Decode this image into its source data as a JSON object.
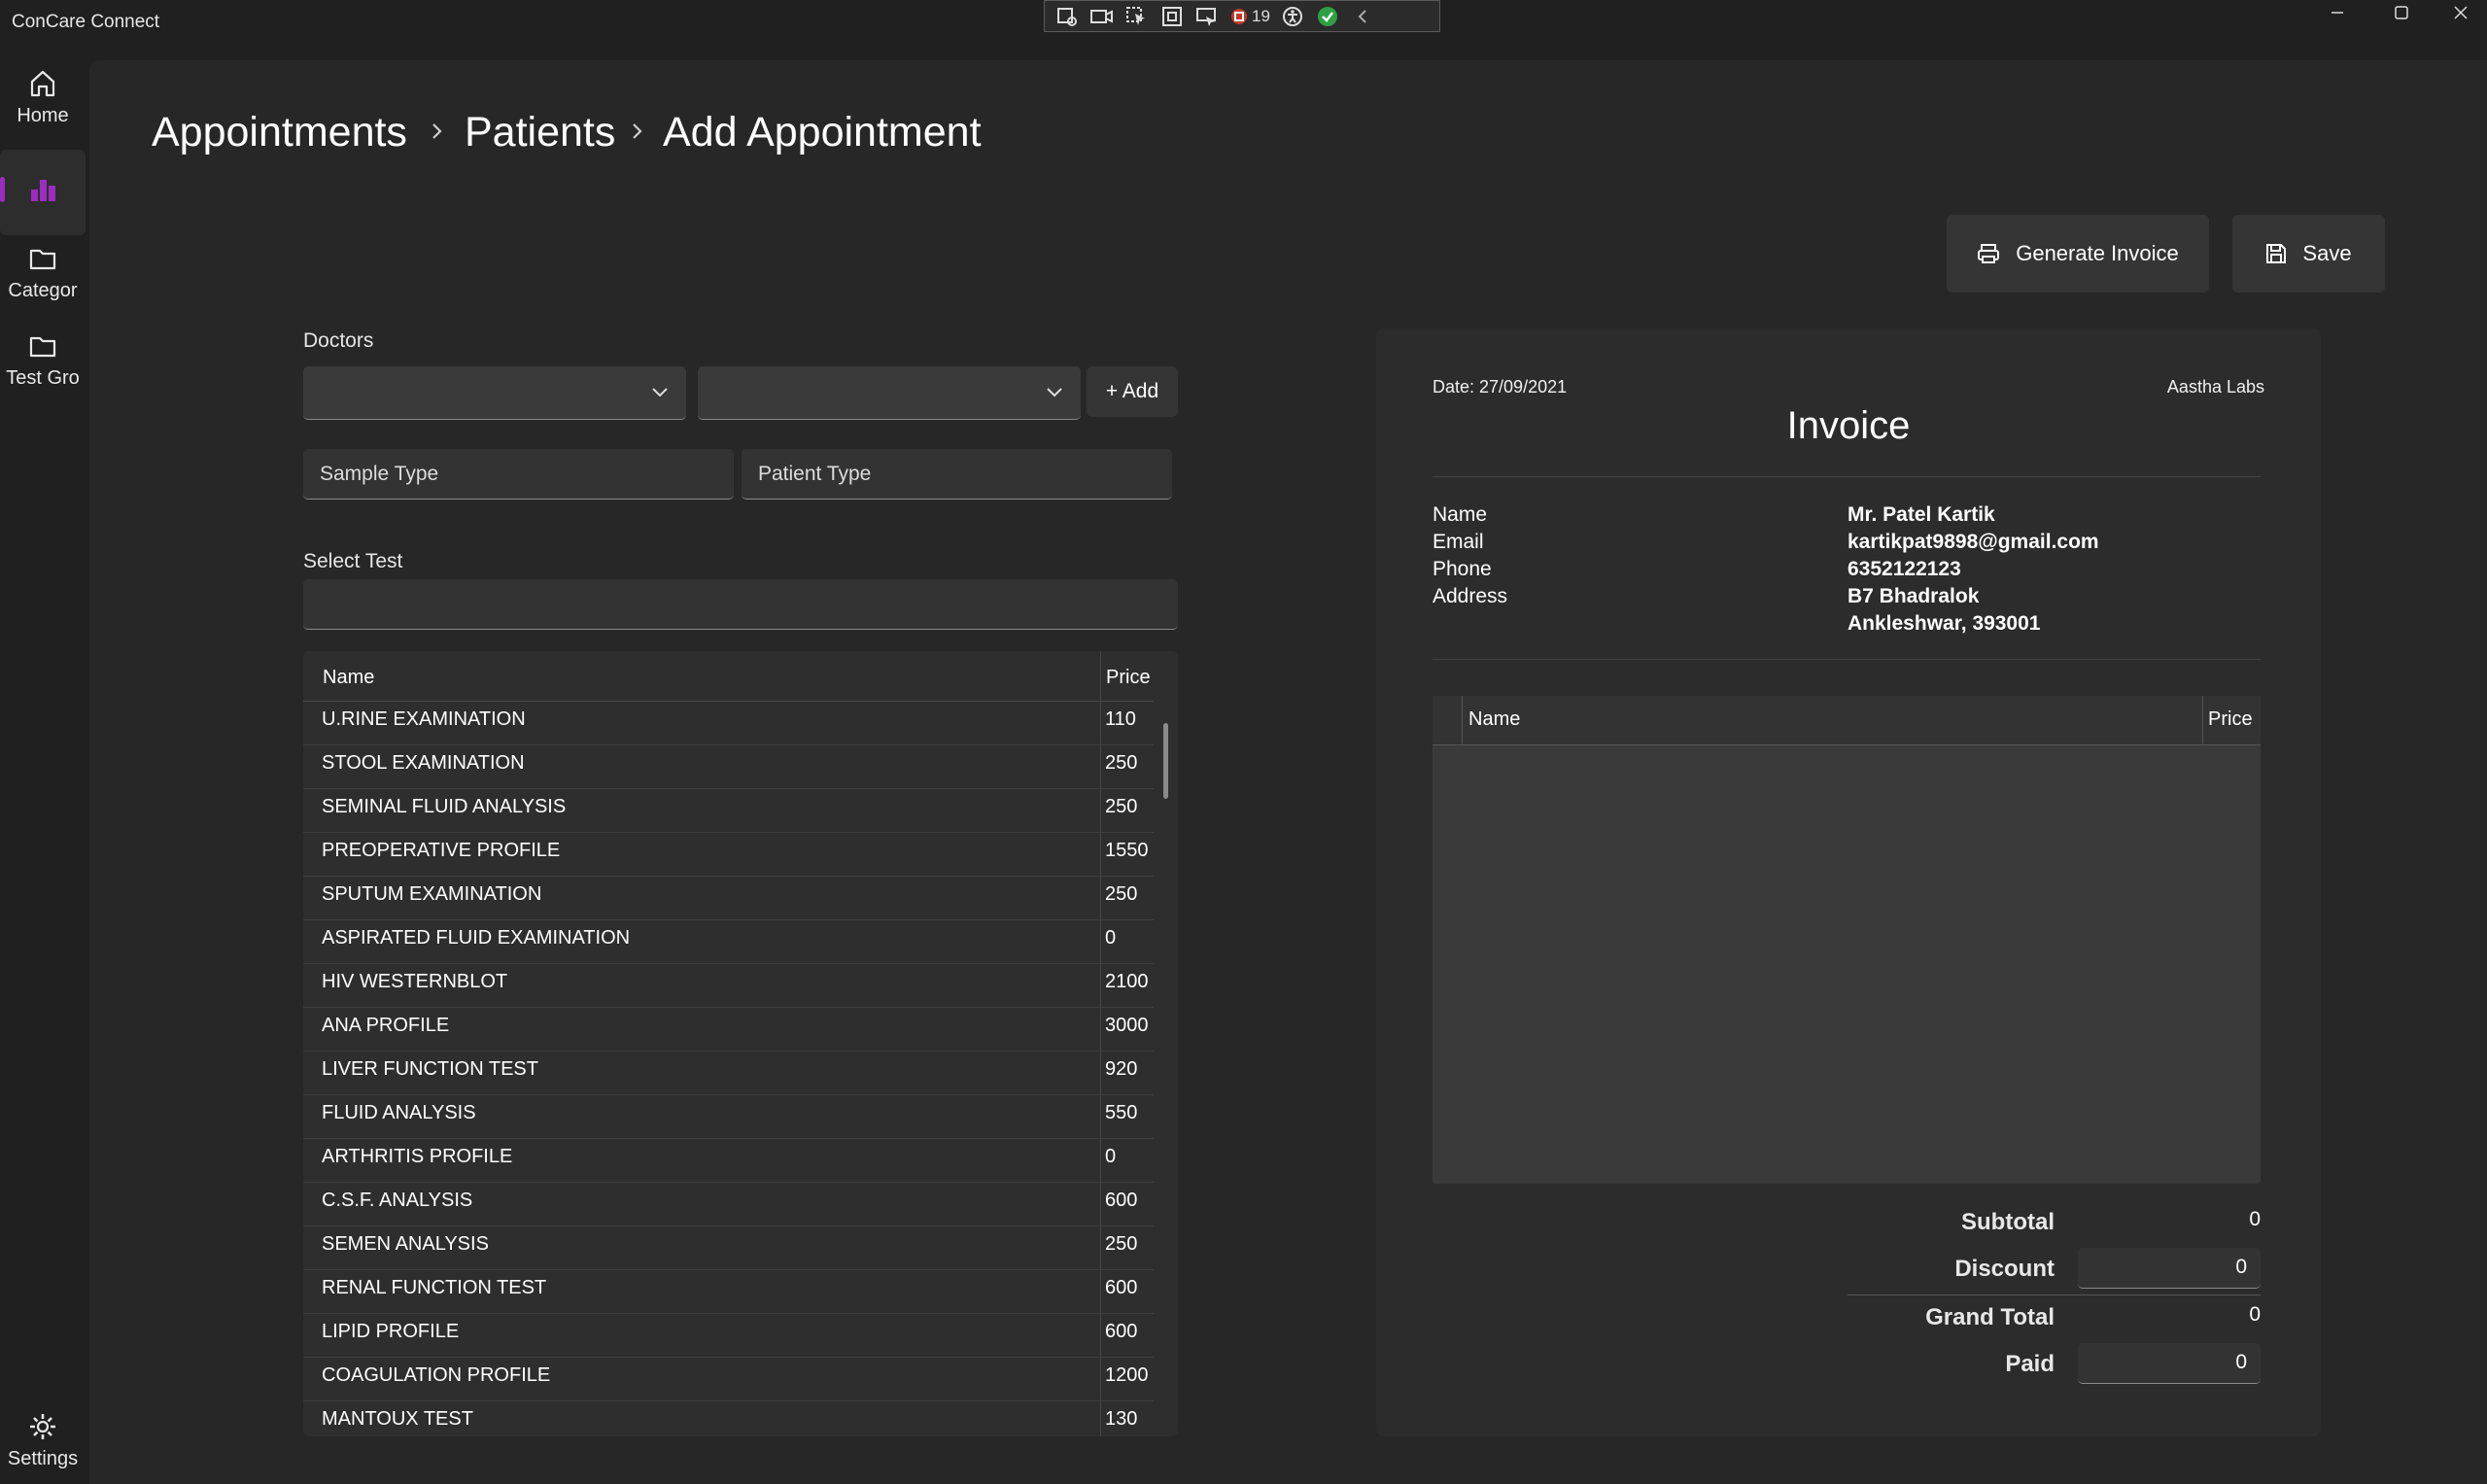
{
  "app": {
    "title": "ConCare Connect"
  },
  "debug_toolbar": {
    "badge_count": "19"
  },
  "nav": {
    "items": [
      {
        "label": "Home",
        "icon": "home-icon"
      },
      {
        "label": "",
        "icon": "bar-chart-icon",
        "selected": true
      },
      {
        "label": "Categor",
        "icon": "folder-icon"
      },
      {
        "label": "Test Gro",
        "icon": "folder-icon"
      }
    ],
    "settings_label": "Settings"
  },
  "breadcrumb": [
    "Appointments",
    "Patients",
    "Add Appointment"
  ],
  "actions": {
    "generate_invoice": "Generate Invoice",
    "save": "Save"
  },
  "form": {
    "doctors_label": "Doctors",
    "add_label": "+ Add",
    "sample_type_placeholder": "Sample Type",
    "patient_type_placeholder": "Patient Type",
    "select_test_label": "Select Test"
  },
  "tests": {
    "headers": {
      "name": "Name",
      "price": "Price"
    },
    "rows": [
      {
        "name": "U.RINE EXAMINATION",
        "price": "110"
      },
      {
        "name": "STOOL EXAMINATION",
        "price": "250"
      },
      {
        "name": "SEMINAL FLUID ANALYSIS",
        "price": "250"
      },
      {
        "name": "PREOPERATIVE PROFILE",
        "price": "1550"
      },
      {
        "name": "SPUTUM EXAMINATION",
        "price": "250"
      },
      {
        "name": "ASPIRATED FLUID EXAMINATION",
        "price": "0"
      },
      {
        "name": "HIV WESTERNBLOT",
        "price": "2100"
      },
      {
        "name": "ANA PROFILE",
        "price": "3000"
      },
      {
        "name": "LIVER FUNCTION TEST",
        "price": "920"
      },
      {
        "name": "FLUID ANALYSIS",
        "price": "550"
      },
      {
        "name": "ARTHRITIS PROFILE",
        "price": "0"
      },
      {
        "name": "C.S.F. ANALYSIS",
        "price": "600"
      },
      {
        "name": "SEMEN ANALYSIS",
        "price": "250"
      },
      {
        "name": "RENAL FUNCTION TEST",
        "price": "600"
      },
      {
        "name": "LIPID PROFILE",
        "price": "600"
      },
      {
        "name": "COAGULATION PROFILE",
        "price": "1200"
      },
      {
        "name": "MANTOUX TEST",
        "price": "130"
      }
    ]
  },
  "invoice": {
    "date": "Date: 27/09/2021",
    "lab": "Aastha Labs",
    "title": "Invoice",
    "fields": [
      {
        "key": "Name",
        "value": "Mr. Patel Kartik"
      },
      {
        "key": "Email",
        "value": "kartikpat9898@gmail.com"
      },
      {
        "key": "Phone",
        "value": "6352122123"
      },
      {
        "key": "Address",
        "value": "B7 Bhadralok"
      }
    ],
    "address_line2": "Ankleshwar, 393001",
    "table_headers": {
      "name": "Name",
      "price": "Price"
    },
    "totals": {
      "subtotal_label": "Subtotal",
      "subtotal": "0",
      "discount_label": "Discount",
      "discount": "0",
      "grand_total_label": "Grand Total",
      "grand_total": "0",
      "paid_label": "Paid",
      "paid": "0"
    }
  },
  "colors": {
    "accent": "#9b2cbf",
    "background": "#202020",
    "panel": "#2c2c2c"
  }
}
